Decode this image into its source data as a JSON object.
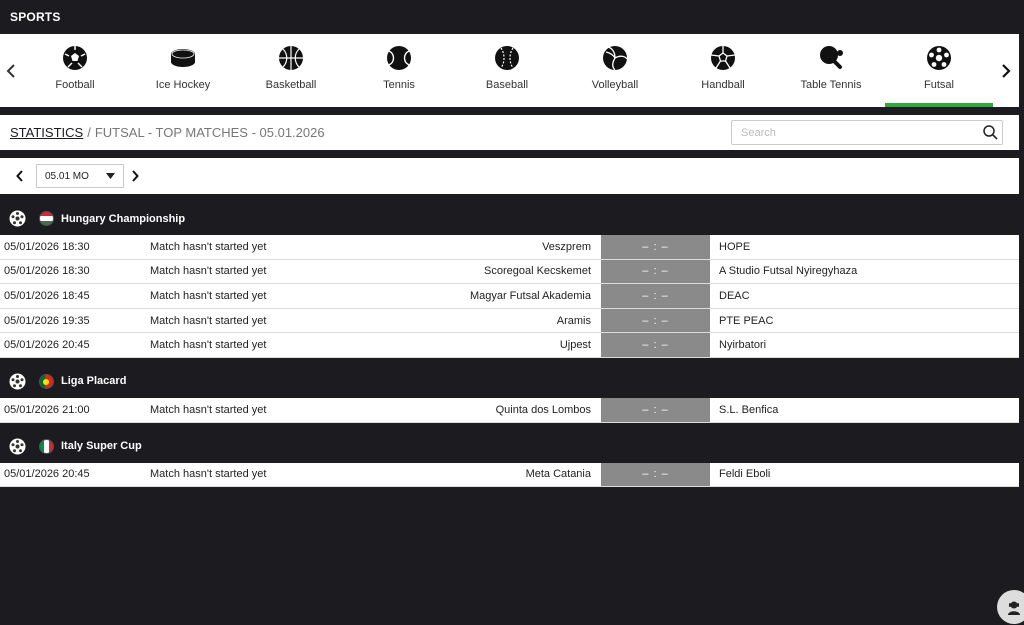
{
  "header": {
    "title": "SPORTS"
  },
  "sports": [
    {
      "label": "Football",
      "icon": "football-icon"
    },
    {
      "label": "Ice Hockey",
      "icon": "hockey-puck-icon"
    },
    {
      "label": "Basketball",
      "icon": "basketball-icon"
    },
    {
      "label": "Tennis",
      "icon": "tennis-ball-icon"
    },
    {
      "label": "Baseball",
      "icon": "baseball-icon"
    },
    {
      "label": "Volleyball",
      "icon": "volleyball-icon"
    },
    {
      "label": "Handball",
      "icon": "handball-icon"
    },
    {
      "label": "Table Tennis",
      "icon": "table-tennis-icon"
    },
    {
      "label": "Futsal",
      "icon": "futsal-ball-icon",
      "active": true
    }
  ],
  "breadcrumb": {
    "link": "STATISTICS",
    "separator": "/",
    "rest": "FUTSAL - TOP MATCHES - 05.01.2026"
  },
  "search": {
    "placeholder": "Search"
  },
  "date": {
    "selected": "05.01 MO"
  },
  "colors": {
    "accent": "#31a83b",
    "background": "#1b1b20",
    "score_bg": "#8a8a8a"
  },
  "leagues": [
    {
      "name": "Hungary Championship",
      "flag": "hungary-flag-icon",
      "matches": [
        {
          "datetime": "05/01/2026 18:30",
          "status": "Match hasn't started yet",
          "home": "Veszprem",
          "score": "– : –",
          "away": "HOPE"
        },
        {
          "datetime": "05/01/2026 18:30",
          "status": "Match hasn't started yet",
          "home": "Scoregoal Kecskemet",
          "score": "– : –",
          "away": "A Studio Futsal Nyiregyhaza"
        },
        {
          "datetime": "05/01/2026 18:45",
          "status": "Match hasn't started yet",
          "home": "Magyar Futsal Akademia",
          "score": "– : –",
          "away": "DEAC"
        },
        {
          "datetime": "05/01/2026 19:35",
          "status": "Match hasn't started yet",
          "home": "Aramis",
          "score": "– : –",
          "away": "PTE PEAC"
        },
        {
          "datetime": "05/01/2026 20:45",
          "status": "Match hasn't started yet",
          "home": "Ujpest",
          "score": "– : –",
          "away": "Nyirbatori"
        }
      ]
    },
    {
      "name": "Liga Placard",
      "flag": "portugal-flag-icon",
      "matches": [
        {
          "datetime": "05/01/2026 21:00",
          "status": "Match hasn't started yet",
          "home": "Quinta dos Lombos",
          "score": "– : –",
          "away": "S.L. Benfica"
        }
      ]
    },
    {
      "name": "Italy Super Cup",
      "flag": "italy-flag-icon",
      "matches": [
        {
          "datetime": "05/01/2026 20:45",
          "status": "Match hasn't started yet",
          "home": "Meta Catania",
          "score": "– : –",
          "away": "Feldi Eboli"
        }
      ]
    }
  ]
}
